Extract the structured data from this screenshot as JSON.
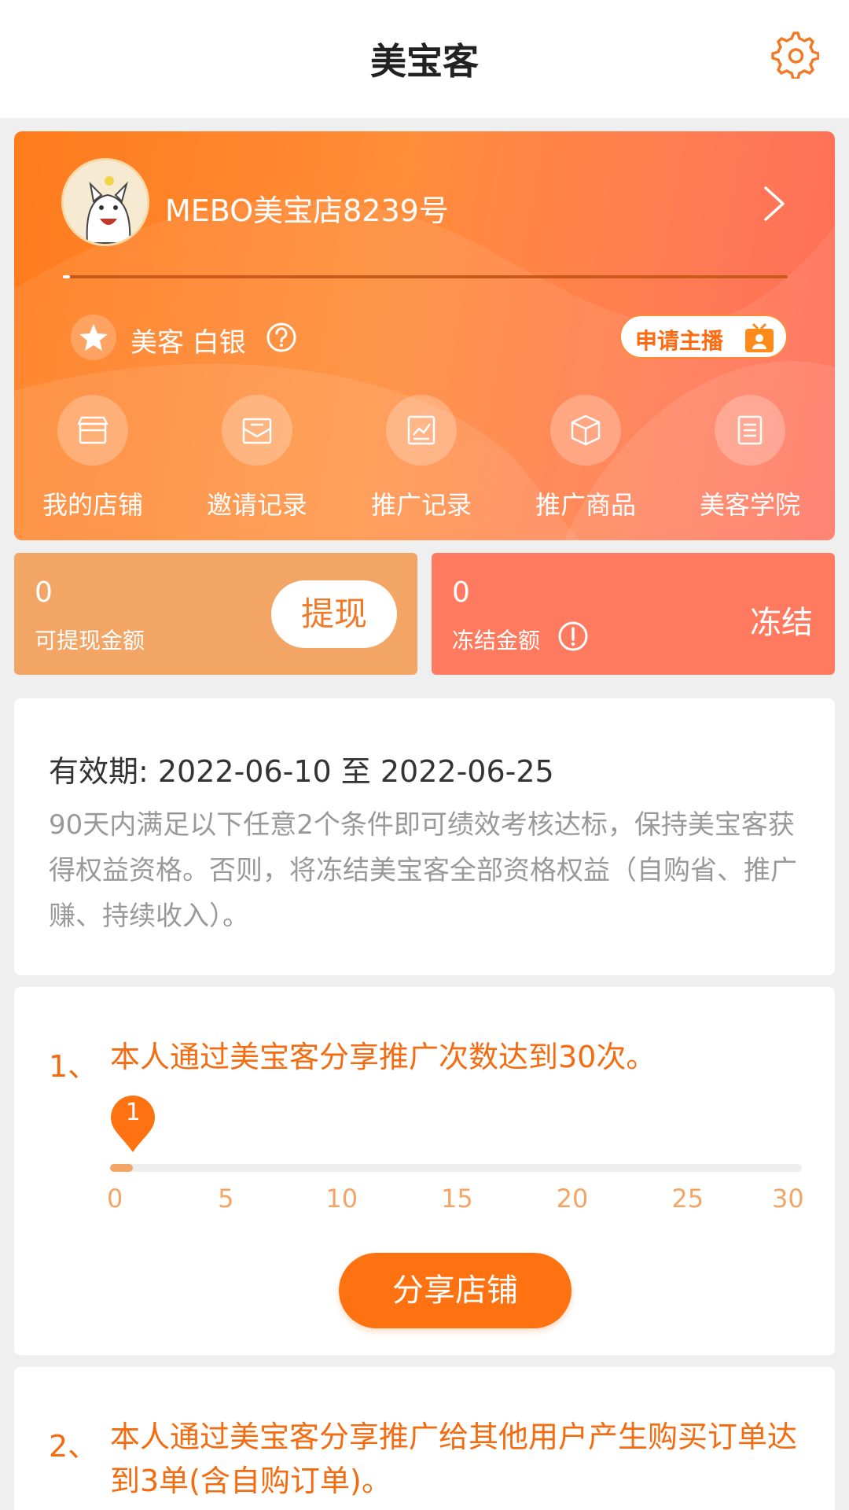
{
  "header": {
    "title": "美宝客",
    "settings_icon": "gear-icon"
  },
  "profile": {
    "store_name": "MEBO美宝店8239号",
    "level_label": "美客 白银",
    "apply_button": "申请主播",
    "level_progress": 0.01
  },
  "menu": {
    "items": [
      {
        "label": "我的店铺",
        "icon": "store-icon"
      },
      {
        "label": "邀请记录",
        "icon": "invite-envelope-icon"
      },
      {
        "label": "推广记录",
        "icon": "chart-report-icon"
      },
      {
        "label": "推广商品",
        "icon": "box-icon"
      },
      {
        "label": "美客学院",
        "icon": "document-icon"
      }
    ]
  },
  "balance": {
    "withdrawable": {
      "amount": "0",
      "label": "可提现金额",
      "button": "提现"
    },
    "frozen": {
      "amount": "0",
      "label": "冻结金额",
      "tag": "冻结"
    }
  },
  "rules": {
    "period": "有效期: 2022-06-10 至 2022-06-25",
    "description": "90天内满足以下任意2个条件即可绩效考核达标，保持美宝客获得权益资格。否则，将冻结美宝客全部资格权益（自购省、推广赚、持续收入）。"
  },
  "task1": {
    "number": "1、",
    "text": "本人通过美宝客分享推广次数达到30次。",
    "current": "1",
    "current_value": 1,
    "max_value": 30,
    "ticks": [
      "0",
      "5",
      "10",
      "15",
      "20",
      "25",
      "30"
    ],
    "button": "分享店铺"
  },
  "task2": {
    "number": "2、",
    "text": "本人通过美宝客分享推广给其他用户产生购买订单达到3单(含自购订单)。"
  },
  "colors": {
    "orange": "#ff7212",
    "light_orange": "#f3a566",
    "coral": "#ff7a5e"
  }
}
